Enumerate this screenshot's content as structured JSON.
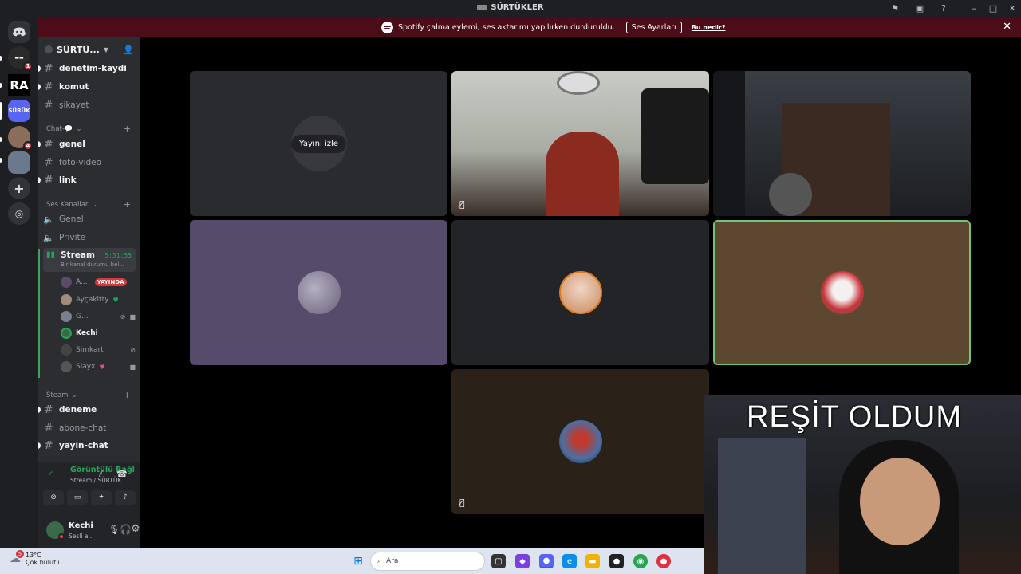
{
  "window": {
    "title": "SÜRTÜKLER"
  },
  "banner": {
    "message": "Spotify çalma eylemi, ses aktarımı yapılırken durduruldu.",
    "button": "Ses Ayarları",
    "link": "Bu nedir?"
  },
  "rail": {
    "servers": [
      {
        "label": "",
        "badge": "1"
      },
      {
        "label": "RA",
        "badge": ""
      },
      {
        "label": "SÜRÜK",
        "badge": ""
      },
      {
        "label": "",
        "badge": "4"
      },
      {
        "label": "",
        "badge": ""
      }
    ]
  },
  "sidebar": {
    "guild_name": "SÜRTÜ...",
    "channels_top": [
      {
        "name": "denetim-kaydi",
        "unread": true
      },
      {
        "name": "komut",
        "unread": true
      },
      {
        "name": "şikayet",
        "unread": false
      }
    ],
    "cat_chat": "Chat-💬",
    "channels_chat": [
      {
        "name": "genel",
        "unread": true
      },
      {
        "name": "foto-video",
        "unread": false
      },
      {
        "name": "link",
        "unread": true
      }
    ],
    "cat_voice": "Ses Kanalları",
    "voice_channels": [
      "Genel",
      "Privite"
    ],
    "active_voice": {
      "name": "Stream",
      "timer": "5:31:55",
      "status": "Bir kanal durumu bel..."
    },
    "voice_users": [
      {
        "name": "A...",
        "live": "YAYINDA"
      },
      {
        "name": "Ayçakitty",
        "live": ""
      },
      {
        "name": "G...",
        "live": ""
      },
      {
        "name": "Kechi",
        "live": ""
      },
      {
        "name": "Simkart",
        "live": ""
      },
      {
        "name": "Slayx",
        "live": ""
      }
    ],
    "cat_steam": "Steam",
    "channels_steam": [
      {
        "name": "deneme",
        "unread": true
      },
      {
        "name": "abone-chat",
        "unread": false
      },
      {
        "name": "yayin-chat",
        "unread": true
      }
    ]
  },
  "voice_panel": {
    "title": "Görüntülü Bağl",
    "subtitle": "Stream / SÜRTÜK..."
  },
  "user": {
    "name": "Kechi",
    "status": "Sesli a..."
  },
  "stage": {
    "watch_label": "Yayını izle"
  },
  "overlay_text": "REŞİT OLDUM",
  "taskbar": {
    "temperature": "13°C",
    "weather": "Çok bulutlu",
    "weather_badge": "5",
    "search_placeholder": "Ara"
  },
  "colors": {
    "accent": "#5865f2",
    "voice_green": "#23a55a",
    "banner": "#4d0d18",
    "live": "#da373c"
  }
}
